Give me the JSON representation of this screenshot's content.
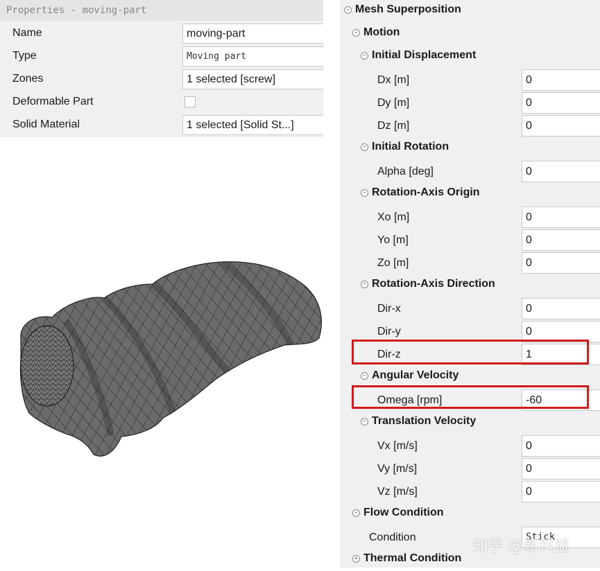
{
  "properties": {
    "title": "Properties - moving-part",
    "rows": [
      {
        "label": "Name",
        "value": "moving-part"
      },
      {
        "label": "Type",
        "value": "Moving part"
      },
      {
        "label": "Zones",
        "value": "1 selected [screw]"
      },
      {
        "label": "Deformable Part",
        "value": ""
      },
      {
        "label": "Solid Material",
        "value": "1 selected [Solid St...]"
      }
    ]
  },
  "tree": {
    "mesh_superposition": "Mesh Superposition",
    "motion": "Motion",
    "initial_displacement": {
      "title": "Initial Displacement",
      "dx": "Dx [m]",
      "dx_val": "0",
      "dy": "Dy [m]",
      "dy_val": "0",
      "dz": "Dz [m]",
      "dz_val": "0"
    },
    "initial_rotation": {
      "title": "Initial Rotation",
      "alpha": "Alpha [deg]",
      "alpha_val": "0"
    },
    "rotation_axis_origin": {
      "title": "Rotation-Axis Origin",
      "xo": "Xo [m]",
      "xo_val": "0",
      "yo": "Yo [m]",
      "yo_val": "0",
      "zo": "Zo [m]",
      "zo_val": "0"
    },
    "rotation_axis_direction": {
      "title": "Rotation-Axis Direction",
      "dirx": "Dir-x",
      "dirx_val": "0",
      "diry": "Dir-y",
      "diry_val": "0",
      "dirz": "Dir-z",
      "dirz_val": "1"
    },
    "angular_velocity": {
      "title": "Angular Velocity",
      "omega": "Omega [rpm]",
      "omega_val": "-60"
    },
    "translation_velocity": {
      "title": "Translation Velocity",
      "vx": "Vx [m/s]",
      "vx_val": "0",
      "vy": "Vy [m/s]",
      "vy_val": "0",
      "vz": "Vz [m/s]",
      "vz_val": "0"
    },
    "flow_condition": {
      "title": "Flow Condition",
      "condition": "Condition",
      "condition_val": "Stick"
    },
    "thermal_condition": "Thermal Condition"
  },
  "watermark": "知乎 @新科益",
  "colors": {
    "highlight": "#d11a1a",
    "mesh_fill": "#6b6b6b",
    "mesh_line": "#1e1e1e"
  }
}
